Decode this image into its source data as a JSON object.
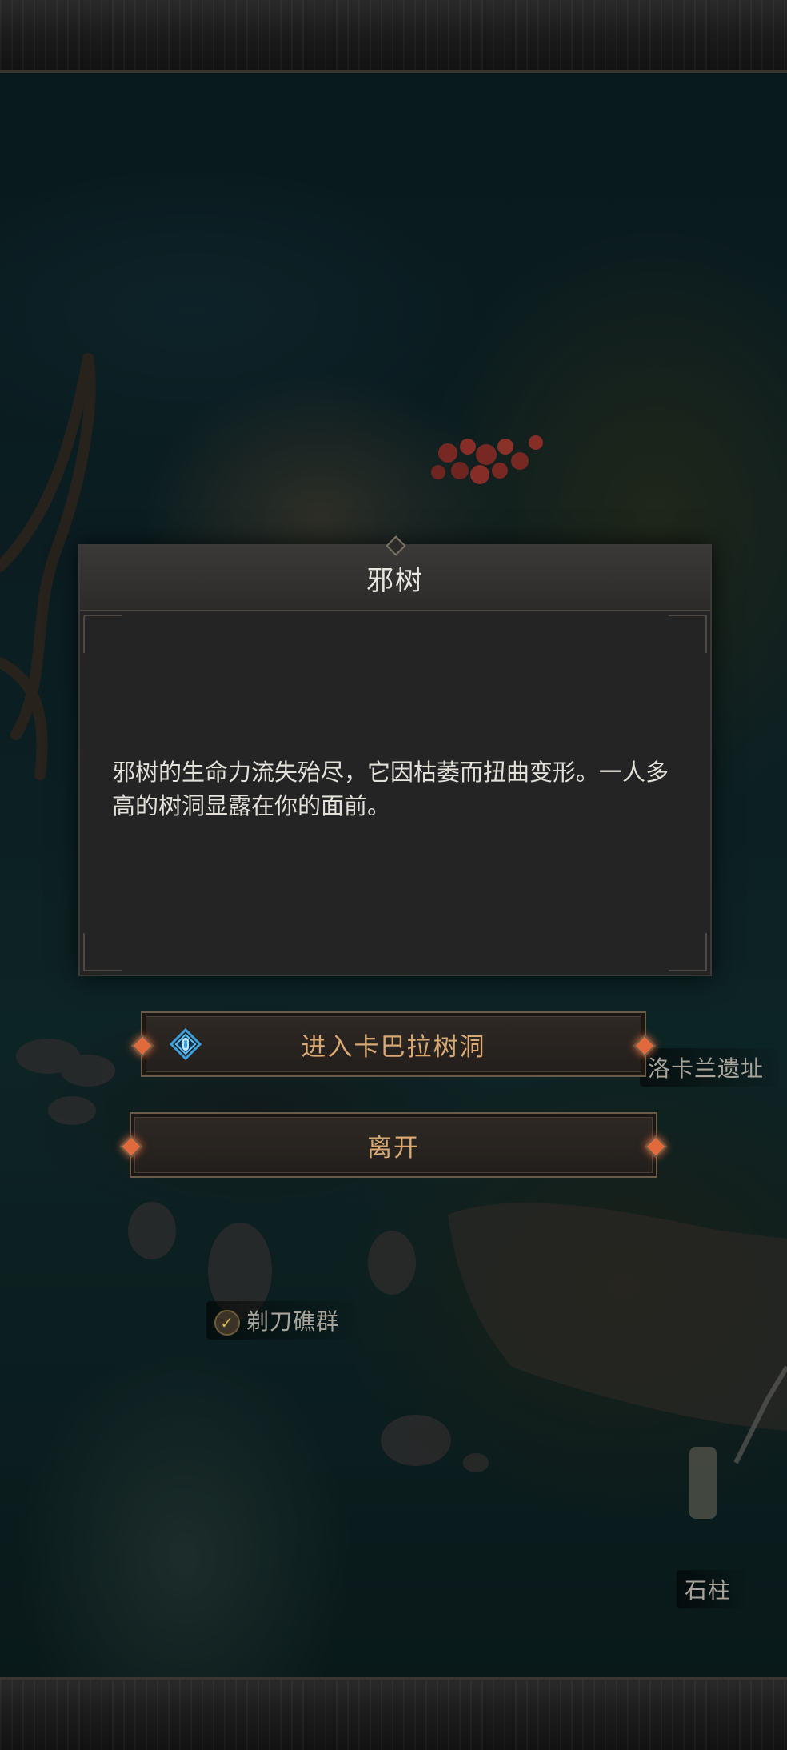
{
  "dialog": {
    "title": "邪树",
    "description": "邪树的生命力流失殆尽，它因枯萎而扭曲变形。一人多高的树洞显露在你的面前。"
  },
  "options": [
    {
      "label": "进入卡巴拉树洞",
      "icon": "portal-icon"
    },
    {
      "label": "离开"
    }
  ],
  "map_labels": {
    "ruins": "洛卡兰遗址",
    "reef": "剃刀礁群",
    "pillar": "石柱"
  },
  "colors": {
    "option_text": "#d9a873",
    "accent_gem": "#e06a3c",
    "icon_blue": "#3aa0e0"
  }
}
